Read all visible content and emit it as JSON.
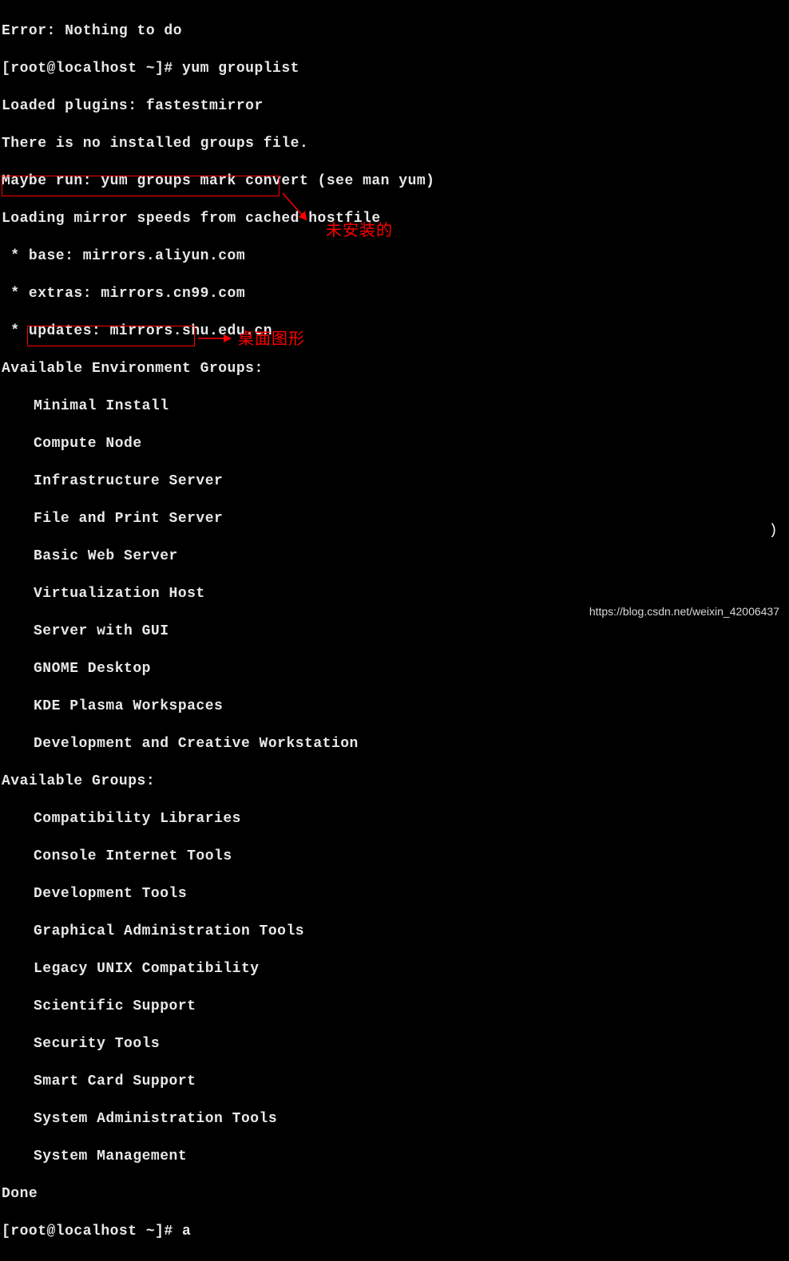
{
  "terminal": {
    "error_line": "Error: Nothing to do",
    "prompt1": "[root@localhost ~]# yum grouplist",
    "loaded_plugins": "Loaded plugins: fastestmirror",
    "no_groups_file": "There is no installed groups file.",
    "maybe_run": "Maybe run: yum groups mark convert (see man yum)",
    "loading_mirror": "Loading mirror speeds from cached hostfile",
    "mirror_base": " * base: mirrors.aliyun.com",
    "mirror_extras": " * extras: mirrors.cn99.com",
    "mirror_updates": " * updates: mirrors.shu.edu.cn",
    "env_groups_header": "Available Environment Groups:",
    "env_groups": {
      "0": "Minimal Install",
      "1": "Compute Node",
      "2": "Infrastructure Server",
      "3": "File and Print Server",
      "4": "Basic Web Server",
      "5": "Virtualization Host",
      "6": "Server with GUI",
      "7": "GNOME Desktop",
      "8": "KDE Plasma Workspaces",
      "9": "Development and Creative Workstation"
    },
    "avail_groups_header": "Available Groups:",
    "avail_groups": {
      "0": "Compatibility Libraries",
      "1": "Console Internet Tools",
      "2": "Development Tools",
      "3": "Graphical Administration Tools",
      "4": "Legacy UNIX Compatibility",
      "5": "Scientific Support",
      "6": "Security Tools",
      "7": "Smart Card Support",
      "8": "System Administration Tools",
      "9": "System Management"
    },
    "done": "Done",
    "prompt2": "[root@localhost ~]# a"
  },
  "annotations": {
    "anno1": "未安装的",
    "anno2": "桌面图形"
  },
  "watermark": "https://blog.csdn.net/weixin_42006437"
}
